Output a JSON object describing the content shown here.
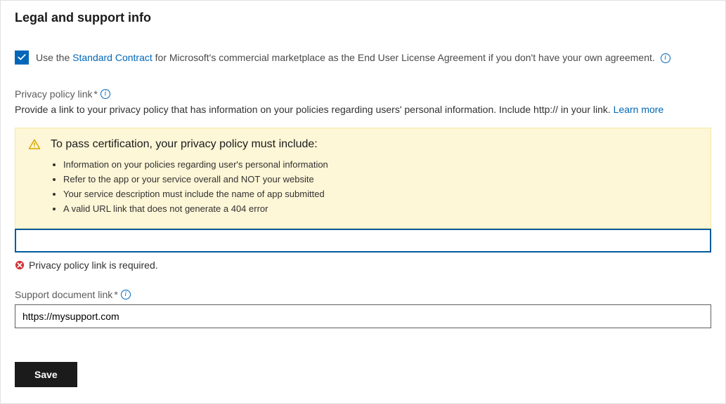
{
  "section_title": "Legal and support info",
  "standard_contract": {
    "use_prefix": "Use the ",
    "link_text": "Standard Contract",
    "suffix": " for Microsoft's commercial marketplace as the End User License Agreement if you don't have your own agreement."
  },
  "privacy_policy": {
    "label": "Privacy policy link",
    "required_marker": "*",
    "help_text": "Provide a link to your privacy policy that has information on your policies regarding users' personal information. Include http:// in your link. ",
    "learn_more": "Learn more",
    "value": "",
    "error": "Privacy policy link is required."
  },
  "warning": {
    "title": "To pass certification, your privacy policy must include:",
    "items": [
      "Information on your policies regarding user's personal information",
      "Refer to the app or your service overall and NOT your website",
      "Your service description must include the name of app submitted",
      "A valid URL link that does not generate a 404 error"
    ]
  },
  "support_document": {
    "label": "Support document link",
    "required_marker": "*",
    "value": "https://mysupport.com"
  },
  "save_button": "Save"
}
